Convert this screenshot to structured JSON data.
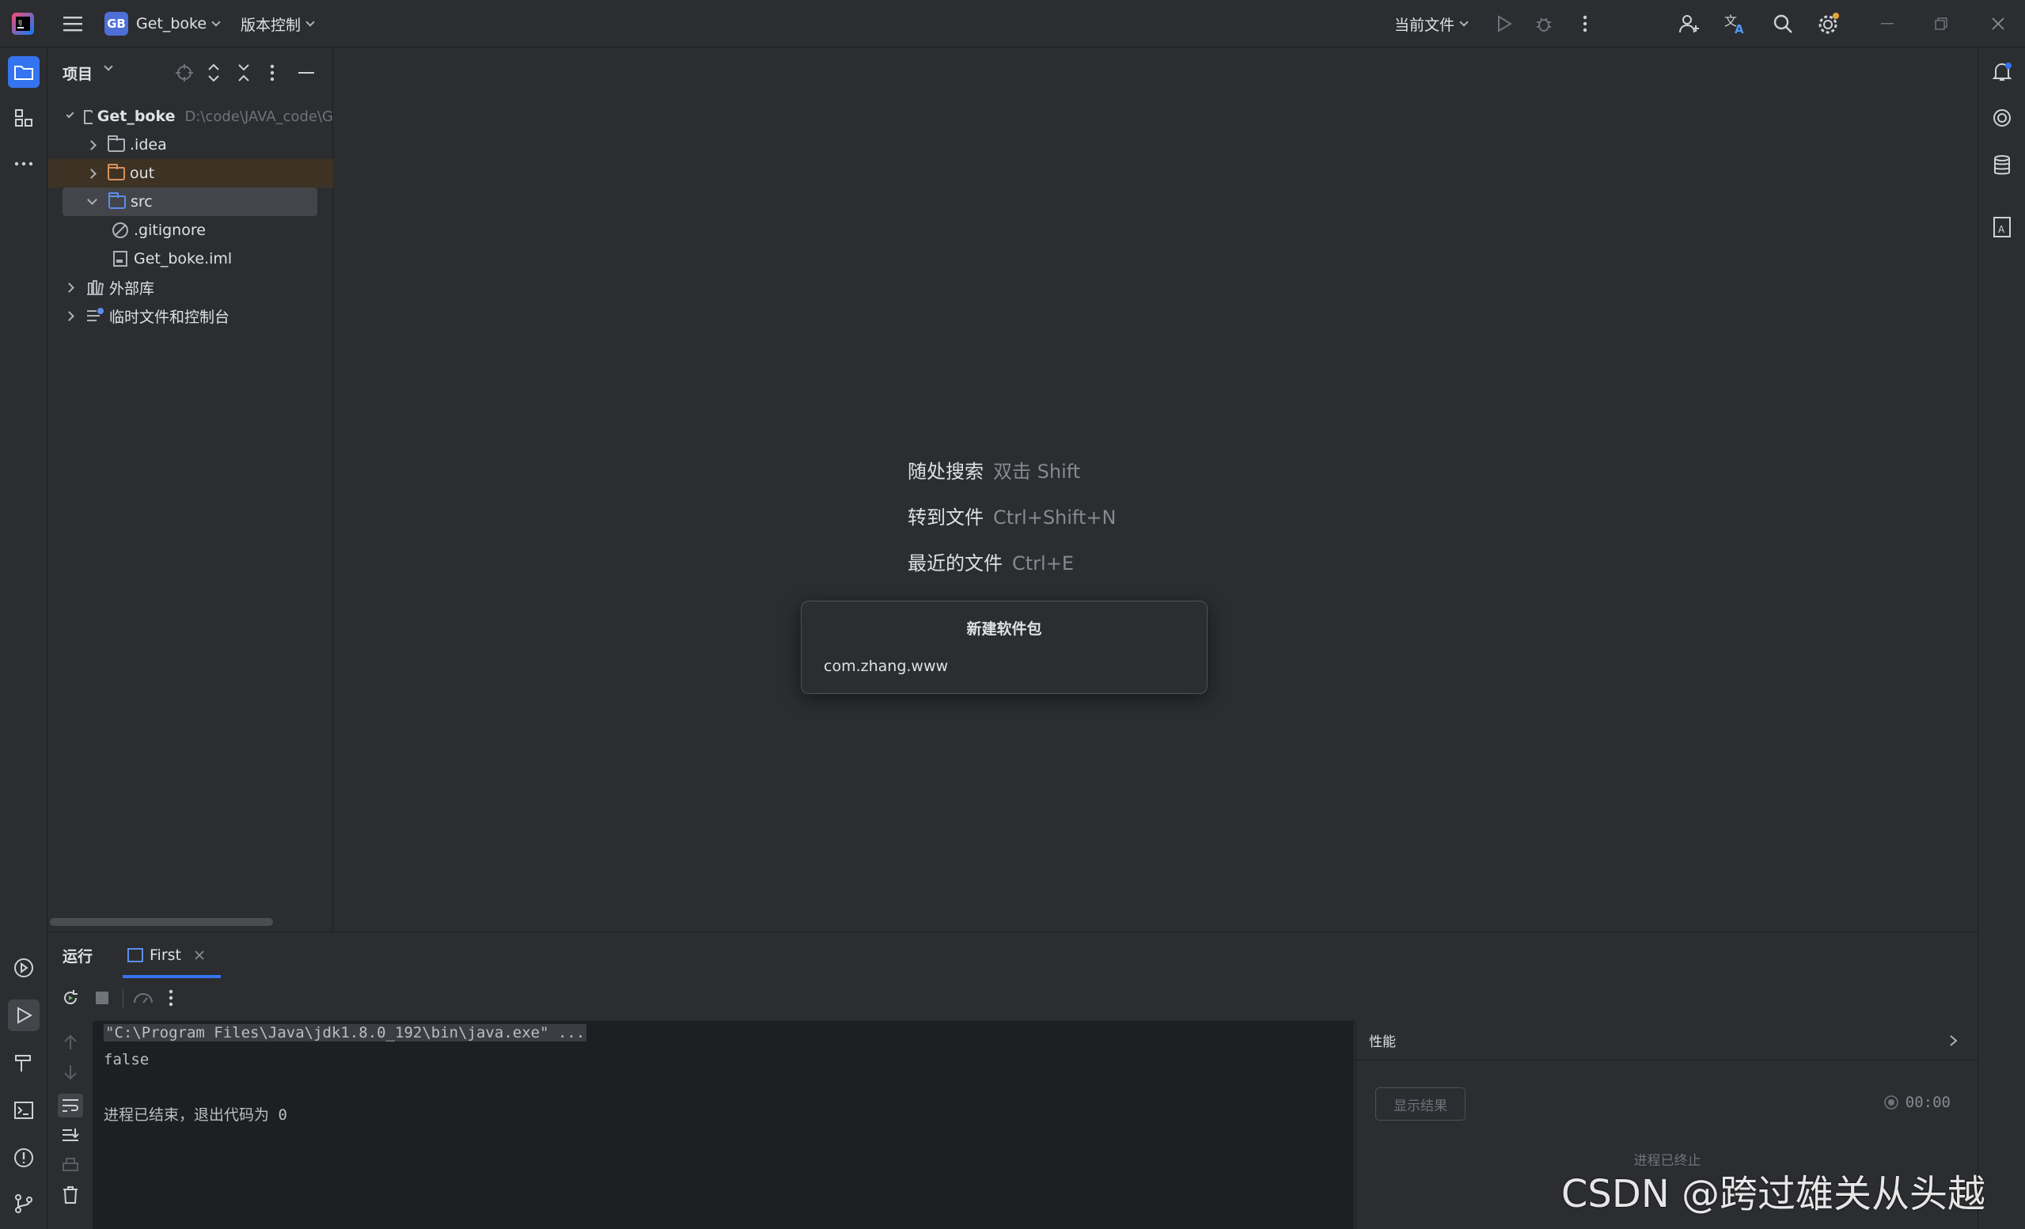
{
  "titlebar": {
    "project_badge": "GB",
    "project_name": "Get_boke",
    "vcs_label": "版本控制",
    "run_config": "当前文件"
  },
  "project_panel": {
    "title": "项目",
    "tree": {
      "root_name": "Get_boke",
      "root_path": "D:\\code\\JAVA_code\\G",
      "items": [
        {
          "label": ".idea"
        },
        {
          "label": "out"
        },
        {
          "label": "src"
        },
        {
          "label": ".gitignore"
        },
        {
          "label": "Get_boke.iml"
        },
        {
          "label": "外部库"
        },
        {
          "label": "临时文件和控制台"
        }
      ]
    }
  },
  "editor": {
    "hints": [
      {
        "action": "随处搜索",
        "shortcut": "双击 Shift"
      },
      {
        "action": "转到文件",
        "shortcut": "Ctrl+Shift+N"
      },
      {
        "action": "最近的文件",
        "shortcut": "Ctrl+E"
      }
    ]
  },
  "popup": {
    "title": "新建软件包",
    "value": "com.zhang.www"
  },
  "run_panel": {
    "tab_run": "运行",
    "tab_config": "First",
    "console": {
      "line1": "\"C:\\Program Files\\Java\\jdk1.8.0_192\\bin\\java.exe\" ...",
      "line2": "false",
      "line3": "进程已结束，退出代码为 0"
    },
    "perf": {
      "title": "性能",
      "show_results": "显示结果",
      "timer": "00:00",
      "status": "进程已终止"
    }
  },
  "watermark": "CSDN @跨过雄关从头越",
  "colors": {
    "accent": "#3574f0",
    "excluded_folder": "#d8915a",
    "source_folder": "#5d8de8"
  }
}
